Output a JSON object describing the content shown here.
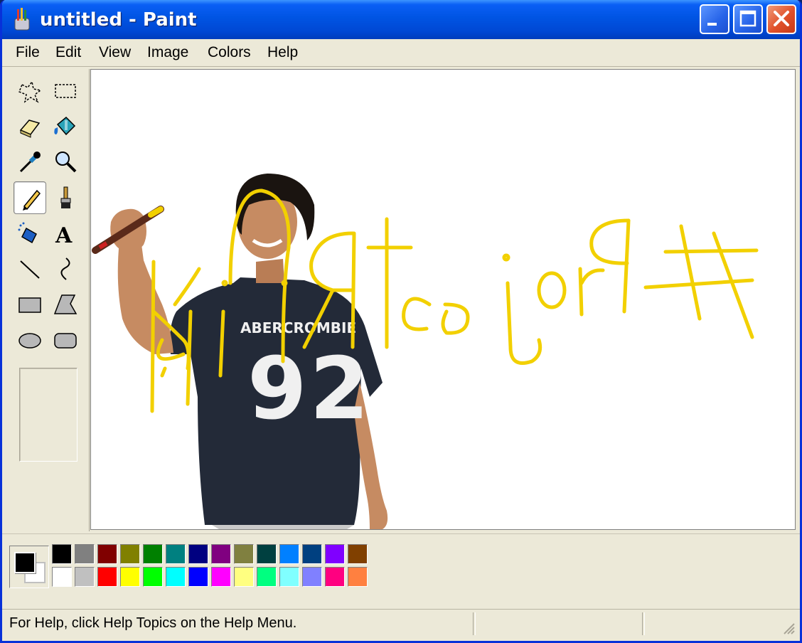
{
  "window": {
    "title": "untitled - Paint"
  },
  "menu": [
    {
      "label": "File"
    },
    {
      "label": "Edit"
    },
    {
      "label": "View"
    },
    {
      "label": "Image"
    },
    {
      "label": "Colors"
    },
    {
      "label": "Help"
    }
  ],
  "tools": [
    {
      "name": "free-form-select-icon"
    },
    {
      "name": "rect-select-icon"
    },
    {
      "name": "eraser-icon"
    },
    {
      "name": "fill-bucket-icon"
    },
    {
      "name": "color-picker-icon"
    },
    {
      "name": "magnifier-icon"
    },
    {
      "name": "pencil-icon",
      "selected": true
    },
    {
      "name": "brush-icon"
    },
    {
      "name": "airbrush-icon"
    },
    {
      "name": "text-icon"
    },
    {
      "name": "line-icon"
    },
    {
      "name": "curve-icon"
    },
    {
      "name": "rectangle-icon"
    },
    {
      "name": "polygon-icon"
    },
    {
      "name": "ellipse-icon"
    },
    {
      "name": "rounded-rect-icon"
    }
  ],
  "canvas": {
    "scribble_color": "#f2d000",
    "shirt_text_brand": "ABERCROMBIE",
    "shirt_text_number": "92"
  },
  "colors": {
    "foreground": "#000000",
    "background": "#ffffff",
    "palette_top": [
      "#000000",
      "#808080",
      "#800000",
      "#808000",
      "#008000",
      "#008080",
      "#000080",
      "#800080",
      "#808040",
      "#004040",
      "#0080ff",
      "#004080",
      "#8000ff",
      "#804000"
    ],
    "palette_bottom": [
      "#ffffff",
      "#c0c0c0",
      "#ff0000",
      "#ffff00",
      "#00ff00",
      "#00ffff",
      "#0000ff",
      "#ff00ff",
      "#ffff80",
      "#00ff80",
      "#80ffff",
      "#8080ff",
      "#ff0080",
      "#ff8040"
    ]
  },
  "status": {
    "text": "For Help, click Help Topics on the Help Menu."
  }
}
